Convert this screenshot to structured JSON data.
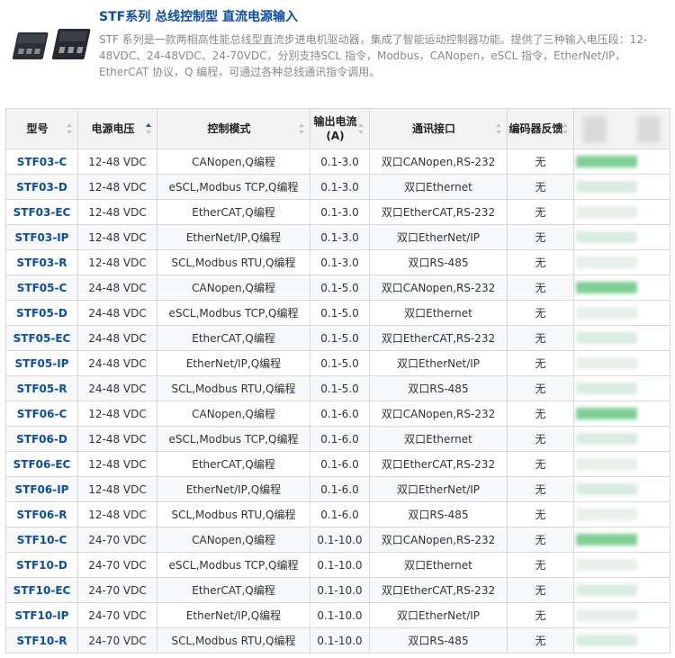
{
  "header": {
    "title": "STF系列 总线控制型 直流电源输入",
    "description": "STF 系列是一款两相高性能总线型直流步进电机驱动器，集成了智能运动控制器功能。提供了三种输入电压段：12-48VDC、24-48VDC、24-70VDC，分别支持SCL 指令，Modbus，CANopen，eSCL 指令，EtherNet/IP，EtherCAT 协议，Q 编程，可通过各种总线通讯指令调用。"
  },
  "table": {
    "headers": [
      "型号",
      "电源电压",
      "控制模式",
      "输出电流(A)",
      "通讯接口",
      "编码器反馈"
    ],
    "rows": [
      {
        "model": "STF03-C",
        "voltage": "12-48 VDC",
        "mode": "CANopen,Q编程",
        "current": "0.1-3.0",
        "interface": "双口CANopen,RS-232",
        "encoder": "无"
      },
      {
        "model": "STF03-D",
        "voltage": "12-48 VDC",
        "mode": "eSCL,Modbus TCP,Q编程",
        "current": "0.1-3.0",
        "interface": "双口Ethernet",
        "encoder": "无"
      },
      {
        "model": "STF03-EC",
        "voltage": "12-48 VDC",
        "mode": "EtherCAT,Q编程",
        "current": "0.1-3.0",
        "interface": "双口EtherCAT,RS-232",
        "encoder": "无"
      },
      {
        "model": "STF03-IP",
        "voltage": "12-48 VDC",
        "mode": "EtherNet/IP,Q编程",
        "current": "0.1-3.0",
        "interface": "双口EtherNet/IP",
        "encoder": "无"
      },
      {
        "model": "STF03-R",
        "voltage": "12-48 VDC",
        "mode": "SCL,Modbus RTU,Q编程",
        "current": "0.1-3.0",
        "interface": "双口RS-485",
        "encoder": "无"
      },
      {
        "model": "STF05-C",
        "voltage": "24-48 VDC",
        "mode": "CANopen,Q编程",
        "current": "0.1-5.0",
        "interface": "双口CANopen,RS-232",
        "encoder": "无"
      },
      {
        "model": "STF05-D",
        "voltage": "24-48 VDC",
        "mode": "eSCL,Modbus TCP,Q编程",
        "current": "0.1-5.0",
        "interface": "双口Ethernet",
        "encoder": "无"
      },
      {
        "model": "STF05-EC",
        "voltage": "24-48 VDC",
        "mode": "EtherCAT,Q编程",
        "current": "0.1-5.0",
        "interface": "双口EtherCAT,RS-232",
        "encoder": "无"
      },
      {
        "model": "STF05-IP",
        "voltage": "24-48 VDC",
        "mode": "EtherNet/IP,Q编程",
        "current": "0.1-5.0",
        "interface": "双口EtherNet/IP",
        "encoder": "无"
      },
      {
        "model": "STF05-R",
        "voltage": "24-48 VDC",
        "mode": "SCL,Modbus RTU,Q编程",
        "current": "0.1-5.0",
        "interface": "双口RS-485",
        "encoder": "无"
      },
      {
        "model": "STF06-C",
        "voltage": "12-48 VDC",
        "mode": "CANopen,Q编程",
        "current": "0.1-6.0",
        "interface": "双口CANopen,RS-232",
        "encoder": "无"
      },
      {
        "model": "STF06-D",
        "voltage": "12-48 VDC",
        "mode": "eSCL,Modbus TCP,Q编程",
        "current": "0.1-6.0",
        "interface": "双口Ethernet",
        "encoder": "无"
      },
      {
        "model": "STF06-EC",
        "voltage": "12-48 VDC",
        "mode": "EtherCAT,Q编程",
        "current": "0.1-6.0",
        "interface": "双口EtherCAT,RS-232",
        "encoder": "无"
      },
      {
        "model": "STF06-IP",
        "voltage": "12-48 VDC",
        "mode": "EtherNet/IP,Q编程",
        "current": "0.1-6.0",
        "interface": "双口EtherNet/IP",
        "encoder": "无"
      },
      {
        "model": "STF06-R",
        "voltage": "12-48 VDC",
        "mode": "SCL,Modbus RTU,Q编程",
        "current": "0.1-6.0",
        "interface": "双口RS-485",
        "encoder": "无"
      },
      {
        "model": "STF10-C",
        "voltage": "24-70 VDC",
        "mode": "CANopen,Q编程",
        "current": "0.1-10.0",
        "interface": "双口CANopen,RS-232",
        "encoder": "无"
      },
      {
        "model": "STF10-D",
        "voltage": "24-70 VDC",
        "mode": "eSCL,Modbus TCP,Q编程",
        "current": "0.1-10.0",
        "interface": "双口Ethernet",
        "encoder": "无"
      },
      {
        "model": "STF10-EC",
        "voltage": "24-70 VDC",
        "mode": "EtherCAT,Q编程",
        "current": "0.1-10.0",
        "interface": "双口EtherCAT,RS-232",
        "encoder": "无"
      },
      {
        "model": "STF10-IP",
        "voltage": "24-70 VDC",
        "mode": "EtherNet/IP,Q编程",
        "current": "0.1-10.0",
        "interface": "双口EtherNet/IP",
        "encoder": "无"
      },
      {
        "model": "STF10-R",
        "voltage": "24-70 VDC",
        "mode": "SCL,Modbus RTU,Q编程",
        "current": "0.1-10.0",
        "interface": "双口RS-485",
        "encoder": "无"
      }
    ]
  },
  "colors": {
    "title": "#0b4fa3",
    "model_link": "#0b4fa3",
    "header_bg": "#f3f3f3",
    "border": "#d9d9d9",
    "sort_active": "#1a4fa0"
  }
}
